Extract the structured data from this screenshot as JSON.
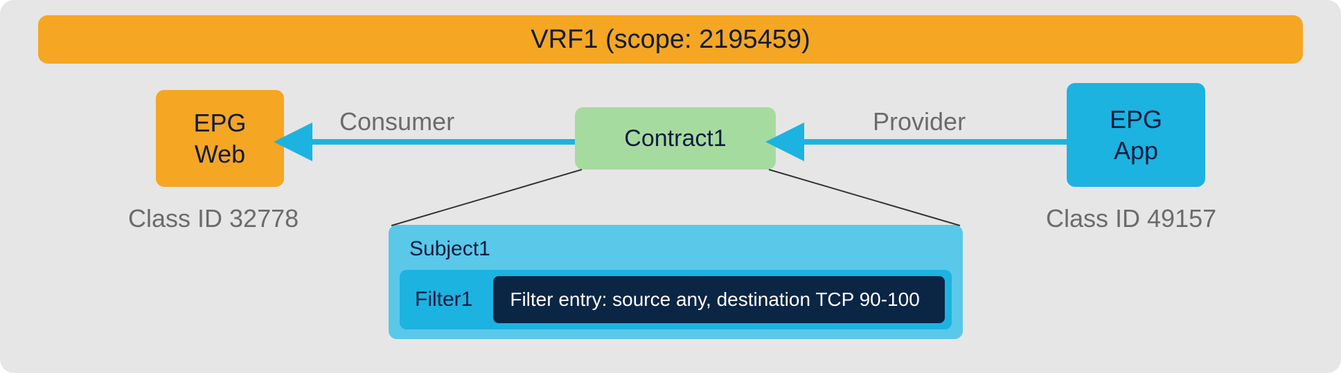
{
  "vrf": {
    "label": "VRF1 (scope: 2195459)"
  },
  "epg_web": {
    "line1": "EPG",
    "line2": "Web",
    "class_id": "Class ID 32778"
  },
  "epg_app": {
    "line1": "EPG",
    "line2": "App",
    "class_id": "Class ID 49157"
  },
  "contract": {
    "label": "Contract1"
  },
  "relations": {
    "consumer": "Consumer",
    "provider": "Provider"
  },
  "subject": {
    "label": "Subject1",
    "filter_label": "Filter1",
    "filter_entry": "Filter entry: source any, destination TCP 90-100"
  },
  "colors": {
    "orange": "#f5a623",
    "green": "#a6dba0",
    "cyan_light": "#5ac8e8",
    "cyan": "#1cb3e0",
    "navy": "#0b2545",
    "gray_text": "#6b6b6b",
    "dark_text": "#0d1c40",
    "bg": "#e6e6e6"
  }
}
